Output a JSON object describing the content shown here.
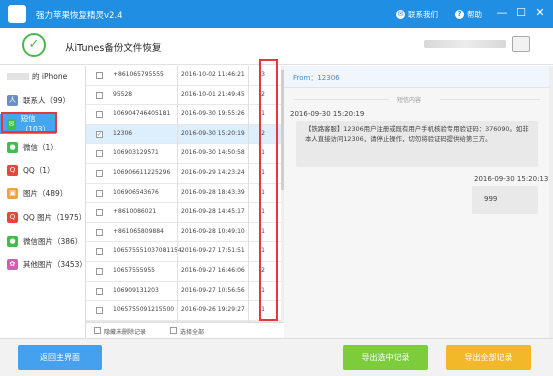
{
  "app": {
    "title": "强力苹果恢复精灵v2.4"
  },
  "titlebar": {
    "contact_label": "联系我们",
    "help_label": "帮助"
  },
  "header": {
    "title": "从iTunes备份文件恢复"
  },
  "sidebar": {
    "device_label": "的 iPhone",
    "items": [
      {
        "label": "联系人（99）",
        "icon": "contacts-icon",
        "color": "#6a8fc7"
      },
      {
        "label": "短信（103）",
        "icon": "sms-icon",
        "color": "#3fbf4a",
        "active": true
      },
      {
        "label": "微信（1）",
        "icon": "wechat-icon",
        "color": "#3fbf4a"
      },
      {
        "label": "QQ（1）",
        "icon": "qq-icon",
        "color": "#e8463a"
      },
      {
        "label": "图片（489）",
        "icon": "photos-icon",
        "color": "#f2a23a"
      },
      {
        "label": "QQ 图片（1975）",
        "icon": "qq-photos-icon",
        "color": "#e8463a"
      },
      {
        "label": "微信图片（386）",
        "icon": "wechat-photos-icon",
        "color": "#3fbf4a"
      },
      {
        "label": "其他图片（3453）",
        "icon": "other-photos-icon",
        "color": "#d05fb3"
      }
    ]
  },
  "messages": {
    "rows": [
      {
        "address": "+861065795555",
        "date": "2016-10-02 11:46:21",
        "count": "3",
        "checked": false
      },
      {
        "address": "95528",
        "date": "2016-10-01 21:49:45",
        "count": "2",
        "checked": false
      },
      {
        "address": "106904746405181",
        "date": "2016-09-30 19:55:26",
        "count": "1",
        "checked": false
      },
      {
        "address": "12306",
        "date": "2016-09-30 15:20:19",
        "count": "2",
        "checked": true
      },
      {
        "address": "106903129571",
        "date": "2016-09-30 14:50:58",
        "count": "1",
        "checked": false
      },
      {
        "address": "106906611225296",
        "date": "2016-09-29 14:23:24",
        "count": "1",
        "checked": false
      },
      {
        "address": "106906543676",
        "date": "2016-09-28 18:43:39",
        "count": "1",
        "checked": false
      },
      {
        "address": "+8610086021",
        "date": "2016-09-28 14:45:17",
        "count": "1",
        "checked": false
      },
      {
        "address": "+861065809884",
        "date": "2016-09-28 10:49:10",
        "count": "1",
        "checked": false
      },
      {
        "address": "106575551037081154",
        "date": "2016-09-27 17:51:51",
        "count": "1",
        "checked": false
      },
      {
        "address": "10657555955",
        "date": "2016-09-27 16:46:06",
        "count": "2",
        "checked": false
      },
      {
        "address": "106909131203",
        "date": "2016-09-27 10:56:56",
        "count": "1",
        "checked": false
      },
      {
        "address": "1065755091215500",
        "date": "2016-09-26 19:29:27",
        "count": "1",
        "checked": false
      },
      {
        "address": "100861002395",
        "date": "2016-09-24 15:53:11",
        "count": "1",
        "checked": false
      }
    ],
    "hide_deleted_label": "隐藏未删除记录",
    "select_all_label": "选择全部"
  },
  "conversation": {
    "from_label": "From：12306",
    "section_label": "短信内容",
    "incoming_date": "2016-09-30 15:20:19",
    "incoming_text": "【铁路客服】12306用户注册或既有用户手机核验专用验证码：376090。如非本人直接访问12306，请停止操作，切勿将验证码提供给第三方。",
    "outgoing_date": "2016-09-30 15:20:13",
    "outgoing_text": "999"
  },
  "footer": {
    "back_label": "返回主界面",
    "export_selected_label": "导出选中记录",
    "export_all_label": "导出全部记录"
  }
}
